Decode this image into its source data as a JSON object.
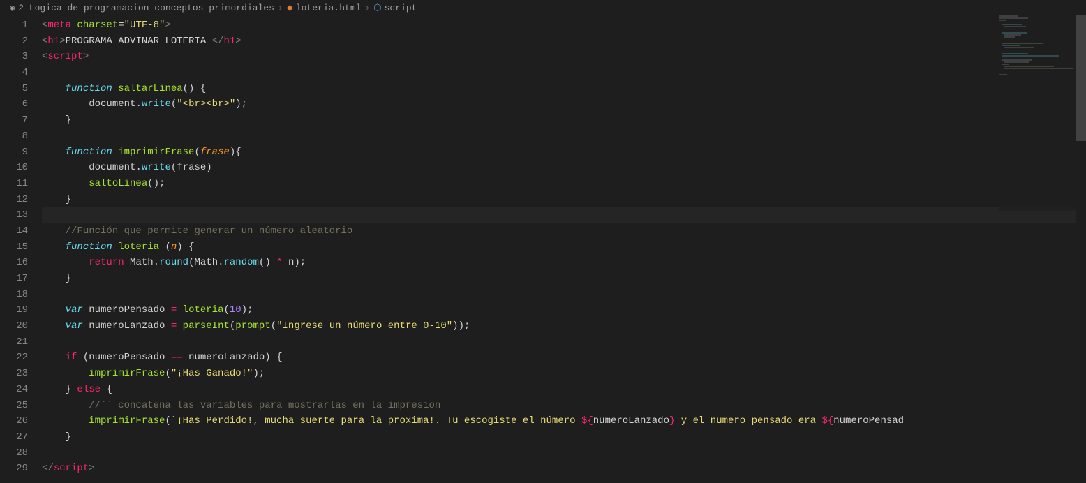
{
  "breadcrumb": {
    "folder": "2 Logica de programacion conceptos primordiales",
    "file": "loteria.html",
    "symbol": "script"
  },
  "code": {
    "lines": [
      {
        "no": 1,
        "tokens": [
          {
            "c": "tag",
            "t": "<"
          },
          {
            "c": "tagname",
            "t": "meta"
          },
          {
            "c": "text",
            "t": " "
          },
          {
            "c": "attr",
            "t": "charset"
          },
          {
            "c": "text",
            "t": "="
          },
          {
            "c": "string",
            "t": "\"UTF-8\""
          },
          {
            "c": "tag",
            "t": ">"
          }
        ]
      },
      {
        "no": 2,
        "tokens": [
          {
            "c": "tag",
            "t": "<"
          },
          {
            "c": "tagname",
            "t": "h1"
          },
          {
            "c": "tag",
            "t": ">"
          },
          {
            "c": "text",
            "t": "PROGRAMA ADVINAR LOTERIA "
          },
          {
            "c": "tag",
            "t": "</"
          },
          {
            "c": "tagname",
            "t": "h1"
          },
          {
            "c": "tag",
            "t": ">"
          }
        ]
      },
      {
        "no": 3,
        "tokens": [
          {
            "c": "tag",
            "t": "<"
          },
          {
            "c": "tagname",
            "t": "script"
          },
          {
            "c": "tag",
            "t": ">"
          }
        ]
      },
      {
        "no": 4,
        "tokens": []
      },
      {
        "no": 5,
        "indent": 1,
        "tokens": [
          {
            "c": "fn-keyword",
            "t": "function"
          },
          {
            "c": "text",
            "t": " "
          },
          {
            "c": "fn-name",
            "t": "saltarLinea"
          },
          {
            "c": "punct",
            "t": "() {"
          }
        ]
      },
      {
        "no": 6,
        "indent": 2,
        "tokens": [
          {
            "c": "object",
            "t": "document"
          },
          {
            "c": "punct",
            "t": "."
          },
          {
            "c": "method",
            "t": "write"
          },
          {
            "c": "punct",
            "t": "("
          },
          {
            "c": "string",
            "t": "\"<br><br>\""
          },
          {
            "c": "punct",
            "t": ");"
          }
        ]
      },
      {
        "no": 7,
        "indent": 1,
        "tokens": [
          {
            "c": "brace",
            "t": "}"
          }
        ]
      },
      {
        "no": 8,
        "tokens": []
      },
      {
        "no": 9,
        "indent": 1,
        "tokens": [
          {
            "c": "fn-keyword",
            "t": "function"
          },
          {
            "c": "text",
            "t": " "
          },
          {
            "c": "fn-name",
            "t": "imprimirFrase"
          },
          {
            "c": "punct",
            "t": "("
          },
          {
            "c": "param",
            "t": "frase"
          },
          {
            "c": "punct",
            "t": "){"
          }
        ]
      },
      {
        "no": 10,
        "indent": 2,
        "tokens": [
          {
            "c": "object",
            "t": "document"
          },
          {
            "c": "punct",
            "t": "."
          },
          {
            "c": "method",
            "t": "write"
          },
          {
            "c": "punct",
            "t": "("
          },
          {
            "c": "text",
            "t": "frase"
          },
          {
            "c": "punct",
            "t": ")"
          }
        ]
      },
      {
        "no": 11,
        "indent": 2,
        "tokens": [
          {
            "c": "call",
            "t": "saltoLinea"
          },
          {
            "c": "punct",
            "t": "();"
          }
        ]
      },
      {
        "no": 12,
        "indent": 1,
        "tokens": [
          {
            "c": "brace",
            "t": "}"
          }
        ]
      },
      {
        "no": 13,
        "highlighted": true,
        "tokens": []
      },
      {
        "no": 14,
        "indent": 1,
        "tokens": [
          {
            "c": "comment",
            "t": "//Función que permite generar un número aleatorio"
          }
        ]
      },
      {
        "no": 15,
        "indent": 1,
        "tokens": [
          {
            "c": "fn-keyword",
            "t": "function"
          },
          {
            "c": "text",
            "t": " "
          },
          {
            "c": "fn-name",
            "t": "loteria "
          },
          {
            "c": "punct",
            "t": "("
          },
          {
            "c": "param",
            "t": "n"
          },
          {
            "c": "punct",
            "t": ") {"
          }
        ]
      },
      {
        "no": 16,
        "indent": 2,
        "tokens": [
          {
            "c": "return-kw",
            "t": "return"
          },
          {
            "c": "text",
            "t": " Math"
          },
          {
            "c": "punct",
            "t": "."
          },
          {
            "c": "method",
            "t": "round"
          },
          {
            "c": "punct",
            "t": "("
          },
          {
            "c": "text",
            "t": "Math"
          },
          {
            "c": "punct",
            "t": "."
          },
          {
            "c": "method",
            "t": "random"
          },
          {
            "c": "punct",
            "t": "() "
          },
          {
            "c": "op",
            "t": "*"
          },
          {
            "c": "text",
            "t": " n"
          },
          {
            "c": "punct",
            "t": ");"
          }
        ]
      },
      {
        "no": 17,
        "indent": 1,
        "tokens": [
          {
            "c": "brace",
            "t": "}"
          }
        ]
      },
      {
        "no": 18,
        "tokens": []
      },
      {
        "no": 19,
        "indent": 1,
        "tokens": [
          {
            "c": "var-kw",
            "t": "var"
          },
          {
            "c": "text",
            "t": " numeroPensado "
          },
          {
            "c": "op",
            "t": "="
          },
          {
            "c": "text",
            "t": " "
          },
          {
            "c": "call",
            "t": "loteria"
          },
          {
            "c": "punct",
            "t": "("
          },
          {
            "c": "number",
            "t": "10"
          },
          {
            "c": "punct",
            "t": ");"
          }
        ]
      },
      {
        "no": 20,
        "indent": 1,
        "tokens": [
          {
            "c": "var-kw",
            "t": "var"
          },
          {
            "c": "text",
            "t": " numeroLanzado "
          },
          {
            "c": "op",
            "t": "="
          },
          {
            "c": "text",
            "t": " "
          },
          {
            "c": "call",
            "t": "parseInt"
          },
          {
            "c": "punct",
            "t": "("
          },
          {
            "c": "call",
            "t": "prompt"
          },
          {
            "c": "punct",
            "t": "("
          },
          {
            "c": "string",
            "t": "\"Ingrese un número entre 0-10\""
          },
          {
            "c": "punct",
            "t": "));"
          }
        ]
      },
      {
        "no": 21,
        "tokens": []
      },
      {
        "no": 22,
        "indent": 1,
        "tokens": [
          {
            "c": "if-kw",
            "t": "if"
          },
          {
            "c": "text",
            "t": " "
          },
          {
            "c": "punct",
            "t": "("
          },
          {
            "c": "text",
            "t": "numeroPensado "
          },
          {
            "c": "op",
            "t": "=="
          },
          {
            "c": "text",
            "t": " numeroLanzado"
          },
          {
            "c": "punct",
            "t": ") {"
          }
        ]
      },
      {
        "no": 23,
        "indent": 2,
        "tokens": [
          {
            "c": "call",
            "t": "imprimirFrase"
          },
          {
            "c": "punct",
            "t": "("
          },
          {
            "c": "string",
            "t": "\"¡Has Ganado!\""
          },
          {
            "c": "punct",
            "t": ");"
          }
        ]
      },
      {
        "no": 24,
        "indent": 1,
        "tokens": [
          {
            "c": "brace",
            "t": "}"
          },
          {
            "c": "text",
            "t": " "
          },
          {
            "c": "else-kw",
            "t": "else"
          },
          {
            "c": "text",
            "t": " "
          },
          {
            "c": "brace",
            "t": "{"
          }
        ]
      },
      {
        "no": 25,
        "indent": 2,
        "tokens": [
          {
            "c": "comment",
            "t": "//`` concatena las variables para mostrarlas en la impresion"
          }
        ]
      },
      {
        "no": 26,
        "indent": 2,
        "tokens": [
          {
            "c": "call",
            "t": "imprimirFrase"
          },
          {
            "c": "punct",
            "t": "("
          },
          {
            "c": "string",
            "t": "`¡Has Perdido!, mucha suerte para la proxima!. Tu escogiste el número "
          },
          {
            "c": "interp",
            "t": "${"
          },
          {
            "c": "interp-var",
            "t": "numeroLanzado"
          },
          {
            "c": "interp",
            "t": "}"
          },
          {
            "c": "string",
            "t": " y el numero pensado era "
          },
          {
            "c": "interp",
            "t": "${"
          },
          {
            "c": "interp-var",
            "t": "numeroPensad"
          }
        ]
      },
      {
        "no": 27,
        "indent": 1,
        "tokens": [
          {
            "c": "brace",
            "t": "}"
          }
        ]
      },
      {
        "no": 28,
        "tokens": []
      },
      {
        "no": 29,
        "tokens": [
          {
            "c": "tag",
            "t": "</"
          },
          {
            "c": "tagname",
            "t": "script"
          },
          {
            "c": "tag",
            "t": ">"
          }
        ]
      }
    ]
  }
}
